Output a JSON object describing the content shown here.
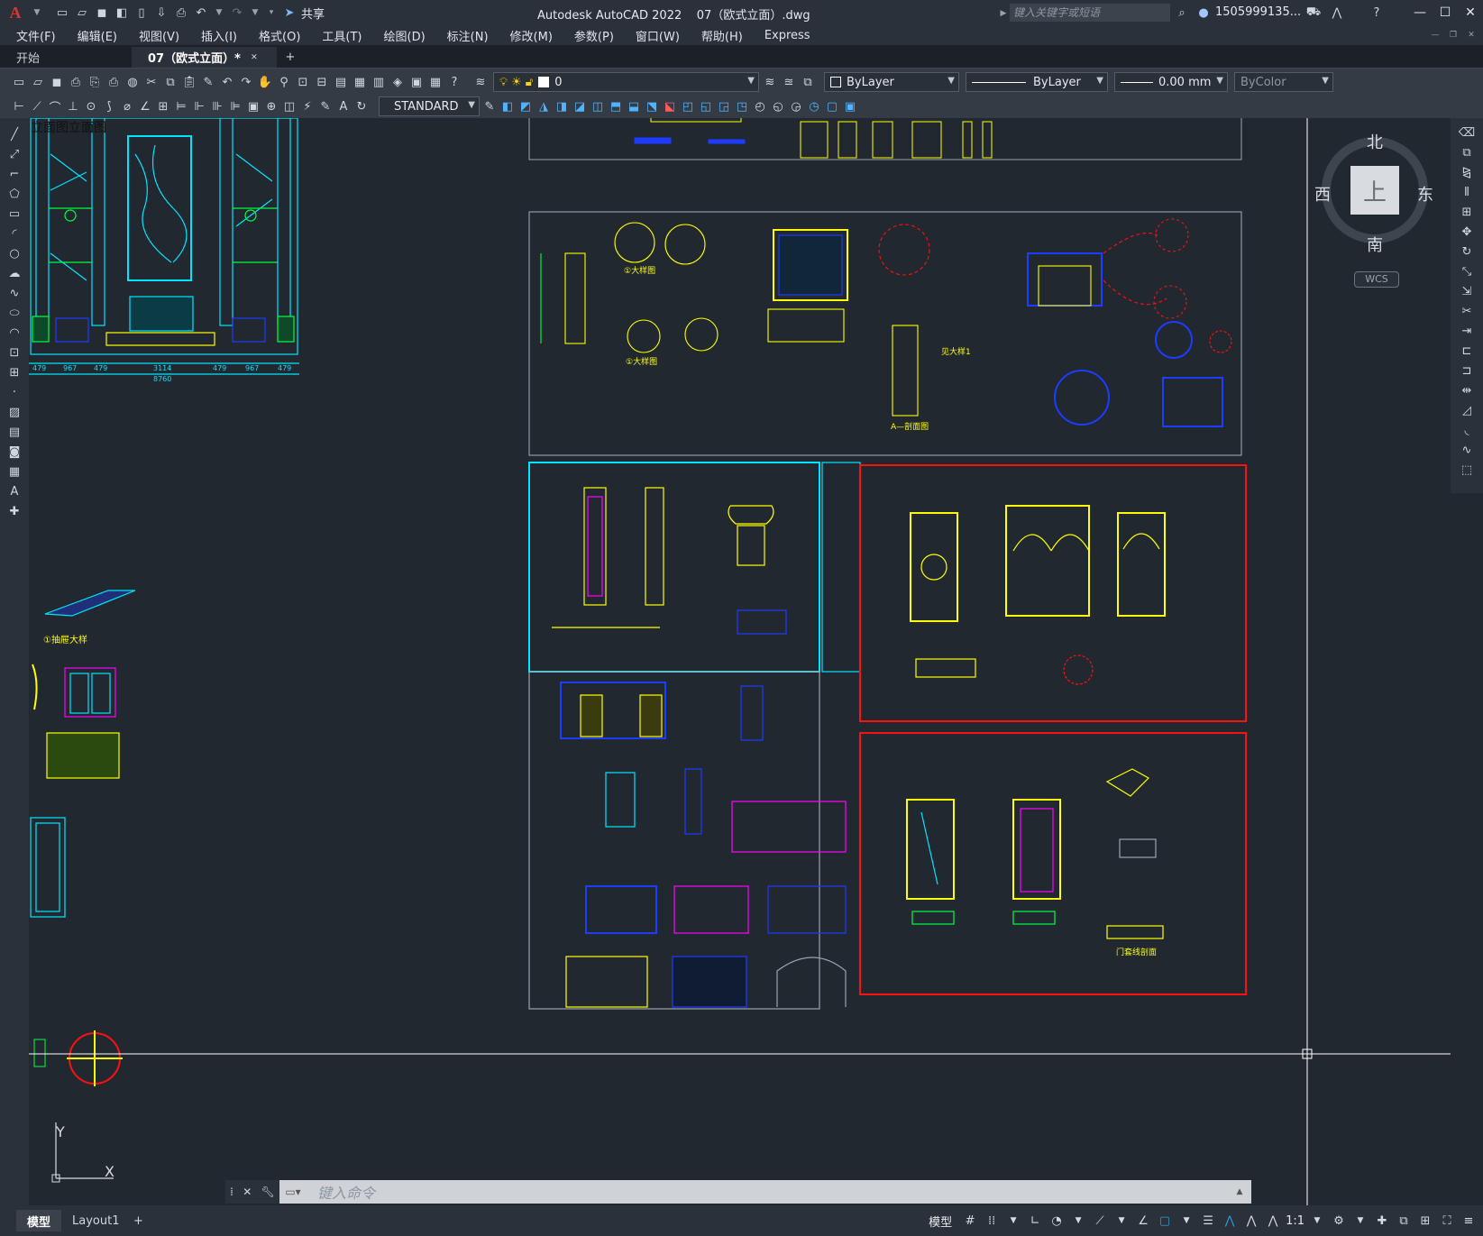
{
  "app": {
    "title": "Autodesk AutoCAD 2022",
    "filename": "07（欧式立面）.dwg",
    "logo": "A",
    "share_label": "共享",
    "search_placeholder": "键入关键字或短语",
    "user": "1505999135..."
  },
  "menu": [
    "文件(F)",
    "编辑(E)",
    "视图(V)",
    "插入(I)",
    "格式(O)",
    "工具(T)",
    "绘图(D)",
    "标注(N)",
    "修改(M)",
    "参数(P)",
    "窗口(W)",
    "帮助(H)",
    "Express"
  ],
  "tabs": [
    {
      "label": "开始"
    },
    {
      "label": "07（欧式立面）*"
    }
  ],
  "toolbar": {
    "layer": "0",
    "color": "ByLayer",
    "linetype": "ByLayer",
    "lineweight": "0.00 mm",
    "plotstyle": "ByColor",
    "textstyle": "STANDARD"
  },
  "viewcube": {
    "north": "北",
    "south": "南",
    "east": "东",
    "west": "西",
    "face": "上",
    "wcs": "WCS"
  },
  "drawing": {
    "elev_title": "立面图立面图",
    "dims": [
      "479",
      "967",
      "479",
      "3114",
      "479",
      "967",
      "479"
    ],
    "total_dim": "8760",
    "labels": {
      "drawer": "①抽屉大样",
      "detail1": "①大样图",
      "detail2": "①大样图",
      "section_a": "A—剖面图",
      "see_detail": "见大样1",
      "door_section": "门套线剖面"
    }
  },
  "command": {
    "placeholder": "键入命令"
  },
  "layout_tabs": [
    {
      "label": "模型"
    },
    {
      "label": "Layout1"
    }
  ],
  "status": {
    "model": "模型",
    "scale": "1:1"
  },
  "colors": {
    "bg": "#212830",
    "ui": "#2b313a",
    "cyan": "#00e5ff",
    "yellow": "#ffff00",
    "red": "#ff1010",
    "blue": "#1e3cff",
    "magenta": "#ff00ff",
    "green": "#00ff40"
  }
}
